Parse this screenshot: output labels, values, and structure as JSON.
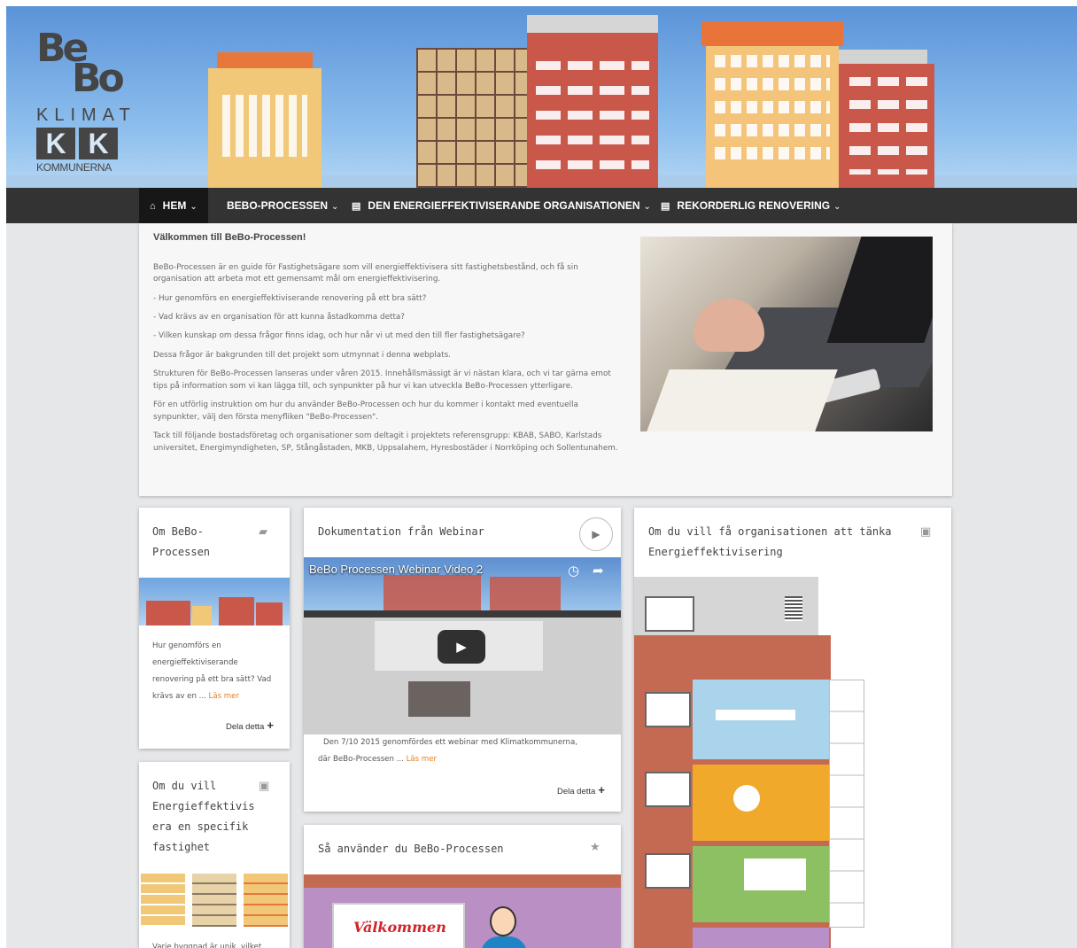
{
  "logo": {
    "bebo_line1": "Be",
    "bebo_line2": "Bo",
    "klimat": "KLIMAT",
    "kk_left": "K",
    "kk_right": "K",
    "kommunerna": "KOMMUNERNA"
  },
  "nav": {
    "items": [
      {
        "label": "HEM",
        "icon": "home-icon"
      },
      {
        "label": "BEBO-PROCESSEN"
      },
      {
        "label": "DEN ENERGIEFFEKTIVISERANDE ORGANISATIONEN",
        "icon": "document-icon"
      },
      {
        "label": "REKORDERLIG RENOVERING",
        "icon": "document-icon"
      }
    ]
  },
  "intro": {
    "title": "Välkommen till BeBo-Processen!",
    "p1": "BeBo-Processen är en guide för Fastighetsägare som vill energieffektivisera sitt fastighetsbestånd, och få sin organisation att arbeta mot ett gemensamt mål om energieffektivisering.",
    "p2": "- Hur genomförs en energieffektiviserande renovering på ett bra sätt?",
    "p3": "- Vad krävs av en organisation för att kunna åstadkomma detta?",
    "p4": "- Vilken kunskap om dessa frågor finns idag, och hur når vi ut med den till fler fastighetsägare?",
    "p5": "Dessa frågor är bakgrunden till det projekt som utmynnat i denna webplats.",
    "p6": "Strukturen för BeBo-Processen lanseras under våren 2015. Innehållsmässigt är vi nästan klara, och vi tar gärna emot tips på information som vi kan lägga till, och synpunkter på hur vi kan utveckla BeBo-Processen ytterligare.",
    "p7": "För en utförlig instruktion om hur du använder BeBo-Processen och hur du kommer i kontakt med eventuella synpunkter, välj den första menyfliken \"BeBo-Processen\".",
    "p8": "Tack till följande bostadsföretag och organisationer som deltagit i projektets referensgrupp: KBAB, SABO, Karlstads universitet, Energimyndigheten, SP, Stångåstaden, MKB, Uppsalahem, Hyresbostäder i Norrköping och Sollentunahem."
  },
  "cards": {
    "om_bebo": {
      "title_l1": "Om BeBo-",
      "title_l2": "Processen",
      "icon": "folder-open-icon",
      "text": "Hur genomförs en energieffektiviserande renovering på ett bra sätt? Vad krävs av en ... ",
      "more": "Läs mer",
      "share": "Dela detta"
    },
    "webinar": {
      "title": "Dokumentation från Webinar",
      "icon": "play-icon",
      "video_title": "BeBo Processen Webinar Video 2",
      "text_l1": "Den 7/10 2015 genomfördes ett webinar med Klimatkommunerna,",
      "text_l2": "där BeBo-Processen ... ",
      "more": "Läs mer",
      "share": "Dela detta"
    },
    "organisation": {
      "title_l1": "Om du vill få organisationen att tänka",
      "title_l2": "Energieffektivisering",
      "icon": "image-icon"
    },
    "fastighet": {
      "title_l1": "Om du vill",
      "title_l2": "Energieffektivis",
      "title_l3": "era en specifik",
      "title_l4": "fastighet",
      "icon": "image-icon",
      "text": "Varje byggnad är unik, vilket"
    },
    "anvander": {
      "title": "Så använder du BeBo-Processen",
      "icon": "star-icon",
      "sign": "Välkommen"
    }
  },
  "colors": {
    "nav": "#333333",
    "link": "#e67e22",
    "page_bg": "#e6e7e9"
  }
}
